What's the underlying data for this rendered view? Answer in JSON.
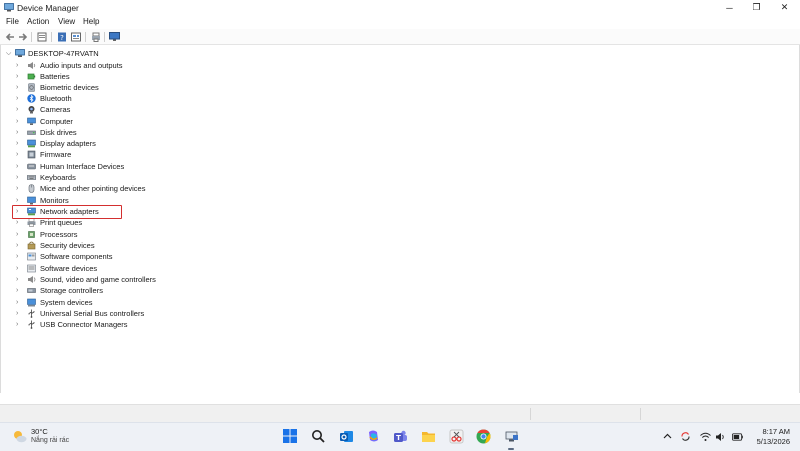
{
  "window": {
    "title": "Device Manager",
    "controls": {
      "minimize": "─",
      "maximize": "❐",
      "close": "✕"
    }
  },
  "menu": [
    "File",
    "Action",
    "View",
    "Help"
  ],
  "toolbar": {
    "icons": [
      "back-arrow-icon",
      "forward-arrow-icon",
      "properties-icon",
      "help-icon",
      "show-hidden-icon",
      "print-icon",
      "monitor-icon"
    ]
  },
  "tree": {
    "root": "DESKTOP-47RVATN",
    "items": [
      {
        "label": "Audio inputs and outputs",
        "icon": "audio-icon"
      },
      {
        "label": "Batteries",
        "icon": "battery-icon"
      },
      {
        "label": "Biometric devices",
        "icon": "biometric-icon"
      },
      {
        "label": "Bluetooth",
        "icon": "bluetooth-icon"
      },
      {
        "label": "Cameras",
        "icon": "camera-icon"
      },
      {
        "label": "Computer",
        "icon": "computer-icon"
      },
      {
        "label": "Disk drives",
        "icon": "disk-icon"
      },
      {
        "label": "Display adapters",
        "icon": "display-adapter-icon"
      },
      {
        "label": "Firmware",
        "icon": "firmware-icon"
      },
      {
        "label": "Human Interface Devices",
        "icon": "hid-icon"
      },
      {
        "label": "Keyboards",
        "icon": "keyboard-icon"
      },
      {
        "label": "Mice and other pointing devices",
        "icon": "mouse-icon"
      },
      {
        "label": "Monitors",
        "icon": "monitor-icon"
      },
      {
        "label": "Network adapters",
        "icon": "network-adapter-icon"
      },
      {
        "label": "Print queues",
        "icon": "printer-icon"
      },
      {
        "label": "Processors",
        "icon": "processor-icon"
      },
      {
        "label": "Security devices",
        "icon": "security-icon"
      },
      {
        "label": "Software components",
        "icon": "software-component-icon"
      },
      {
        "label": "Software devices",
        "icon": "software-device-icon"
      },
      {
        "label": "Sound, video and game controllers",
        "icon": "sound-icon"
      },
      {
        "label": "Storage controllers",
        "icon": "storage-icon"
      },
      {
        "label": "System devices",
        "icon": "system-icon"
      },
      {
        "label": "Universal Serial Bus controllers",
        "icon": "usb-icon"
      },
      {
        "label": "USB Connector Managers",
        "icon": "usb-connector-icon"
      }
    ],
    "highlighted": "Network adapters",
    "highlight_color": "#d32f2f"
  },
  "taskbar": {
    "weather": {
      "temp": "30°C",
      "desc": "Nắng rải rác"
    },
    "apps": [
      "start-icon",
      "search-icon",
      "outlook-icon",
      "copilot-icon",
      "teams-icon",
      "file-explorer-icon",
      "snipping-icon",
      "chrome-icon",
      "device-manager-icon"
    ],
    "tray": [
      "chevron-up-icon",
      "sync-icon",
      "wifi-icon",
      "volume-icon",
      "battery-icon"
    ],
    "clock": {
      "time": "8:17 AM",
      "date": "5/13/2026"
    }
  },
  "colors": {
    "accent": "#0078d4",
    "highlight": "#d32f2f",
    "taskbar": "#eef1f6"
  }
}
